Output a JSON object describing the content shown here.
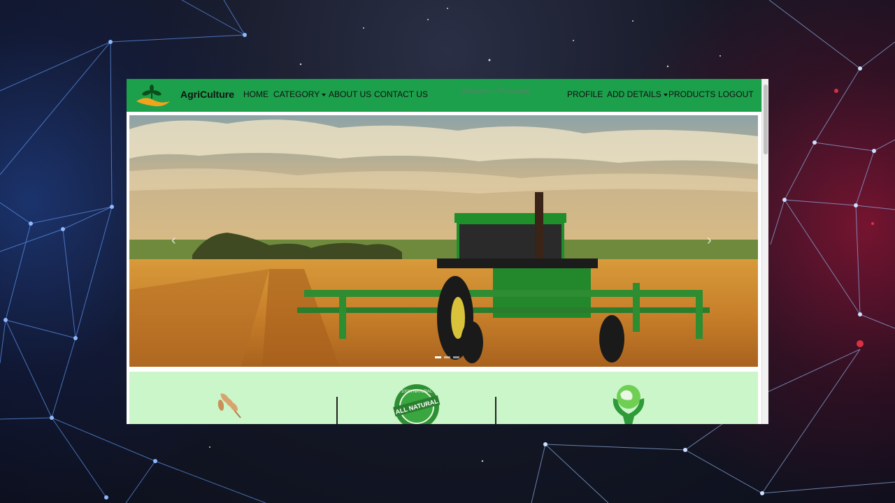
{
  "navbar": {
    "brand": "AgriCulture",
    "left_items": [
      {
        "label": "HOME"
      },
      {
        "label": "CATEGORY",
        "dropdown": true
      },
      {
        "label": "ABOUT US"
      },
      {
        "label": "CONTACT US"
      }
    ],
    "welcome": "Welcome ! Prashant",
    "right_items": [
      {
        "label": "PROFILE"
      },
      {
        "label": "ADD DETAILS",
        "dropdown": true
      },
      {
        "label": "PRODUCTS"
      },
      {
        "label": "LOGOUT"
      }
    ]
  },
  "carousel": {
    "prev": "‹",
    "next": "›",
    "slide_count": 3,
    "active_slide": 1
  },
  "features": [
    {
      "icon": "wheat-icon"
    },
    {
      "icon": "all-natural-badge",
      "badge_text": "ALL NATURAL",
      "badge_ring_text": "100% NATURAL"
    },
    {
      "icon": "earth-in-hands-icon"
    }
  ],
  "colors": {
    "navbar": "#1ca04c",
    "features_bg": "#cbf6c9"
  }
}
